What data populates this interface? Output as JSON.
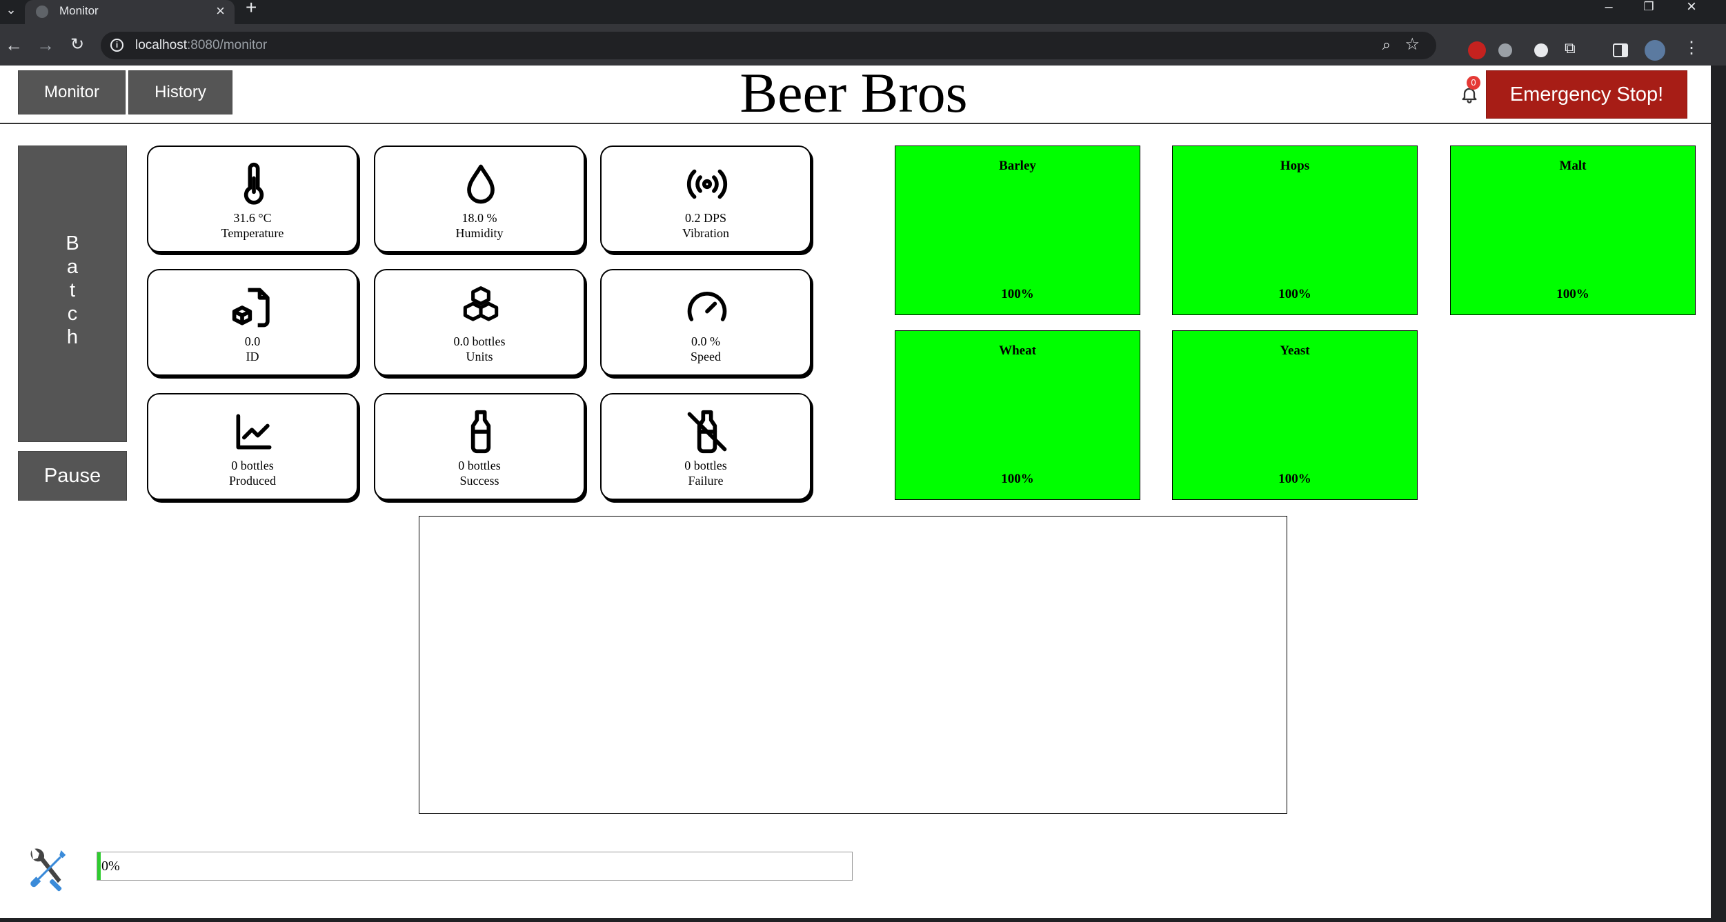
{
  "browser": {
    "tab_title": "Monitor",
    "url_host": "localhost",
    "url_rest": ":8080/monitor"
  },
  "header": {
    "nav": [
      "Monitor",
      "History"
    ],
    "brand": "Beer Bros",
    "notification_count": "0",
    "emergency_label": "Emergency Stop!"
  },
  "controls": {
    "batch_letters": [
      "B",
      "a",
      "t",
      "c",
      "h"
    ],
    "pause_label": "Pause"
  },
  "sensors": [
    {
      "icon": "thermometer-icon",
      "value": "31.6 °C",
      "label": "Temperature"
    },
    {
      "icon": "droplet-icon",
      "value": "18.0 %",
      "label": "Humidity"
    },
    {
      "icon": "vibration-icon",
      "value": "0.2 DPS",
      "label": "Vibration"
    },
    {
      "icon": "batch-id-icon",
      "value": "0.0",
      "label": "ID"
    },
    {
      "icon": "cubes-icon",
      "value": "0.0 bottles",
      "label": "Units"
    },
    {
      "icon": "gauge-icon",
      "value": "0.0 %",
      "label": "Speed"
    },
    {
      "icon": "line-chart-icon",
      "value": "0 bottles",
      "label": "Produced"
    },
    {
      "icon": "bottle-icon",
      "value": "0 bottles",
      "label": "Success"
    },
    {
      "icon": "bottle-off-icon",
      "value": "0 bottles",
      "label": "Failure"
    }
  ],
  "ingredients": [
    {
      "name": "Barley",
      "level": "100%",
      "color": "#00ff00"
    },
    {
      "name": "Hops",
      "level": "100%",
      "color": "#00ff00"
    },
    {
      "name": "Malt",
      "level": "100%",
      "color": "#00ff00"
    },
    {
      "name": "Wheat",
      "level": "100%",
      "color": "#00ff00"
    },
    {
      "name": "Yeast",
      "level": "100%",
      "color": "#00ff00"
    }
  ],
  "maintenance": {
    "icon": "tools-icon",
    "progress_text": "0%",
    "progress_fraction": 0.005
  },
  "colors": {
    "accent_danger": "#a71d16",
    "button_gray": "#555555",
    "ingredient_ok": "#00ff00"
  }
}
